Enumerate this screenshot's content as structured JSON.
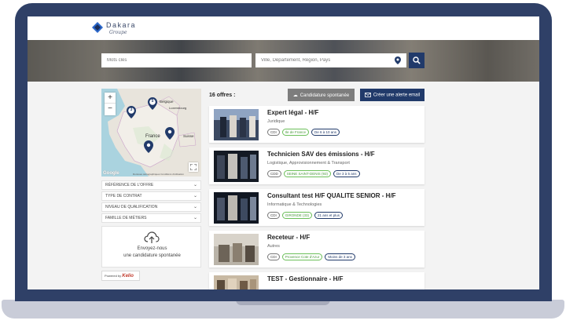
{
  "header": {
    "logo_name": "Dakara",
    "logo_sub": "Groupe"
  },
  "search": {
    "keywords_placeholder": "Mots clés",
    "location_placeholder": "Ville, Département, Région, Pays"
  },
  "map": {
    "labels": [
      "Belgique",
      "Luxembourg",
      "France",
      "Suisse"
    ],
    "markers": [
      "3",
      "5",
      "",
      ""
    ],
    "zoom_in": "+",
    "zoom_out": "−",
    "google": "Google",
    "attribution": "Données cartographiques   Conditions d'utilisation"
  },
  "filters": [
    {
      "label": "Référence de l'offre"
    },
    {
      "label": "Type de contrat"
    },
    {
      "label": "Niveau de qualification"
    },
    {
      "label": "Famille de métiers"
    }
  ],
  "spontaneous": {
    "line1": "Envoyez-nous",
    "line2": "une candidature spontanée"
  },
  "powered": {
    "prefix": "Powered by",
    "brand": "Kelio"
  },
  "results": {
    "count_label": "16 offres :",
    "spont_button": "Candidature spontanée",
    "alert_button": "Créer une alerte email"
  },
  "offers": [
    {
      "title": "Expert légal - H/F",
      "category": "Juridique",
      "contract": "CDI",
      "location": "Ile de France",
      "experience": "De 6 à 10 ans"
    },
    {
      "title": "Technicien SAV des émissions - H/F",
      "category": "Logistique, Approvisionnement & Transport",
      "contract": "CDD",
      "location": "SEINE SAINT-DENIS (93)",
      "experience": "De 3 à 5 ans"
    },
    {
      "title": "Consultant test H/F QUALITE SENIOR - H/F",
      "category": "Informatique & Technologies",
      "contract": "CDI",
      "location": "GIRONDE (33)",
      "experience": "21 ans et plus"
    },
    {
      "title": "Receteur - H/F",
      "category": "Autres",
      "contract": "CDI",
      "location": "Provence Cote d'Azur",
      "experience": "Moins de 3 ans"
    },
    {
      "title": "TEST - Gestionnaire - H/F",
      "category": "",
      "contract": "",
      "location": "",
      "experience": ""
    }
  ],
  "colors": {
    "primary": "#213a6a",
    "bezel": "#2f4067",
    "tag_location": "#6bbf59"
  }
}
